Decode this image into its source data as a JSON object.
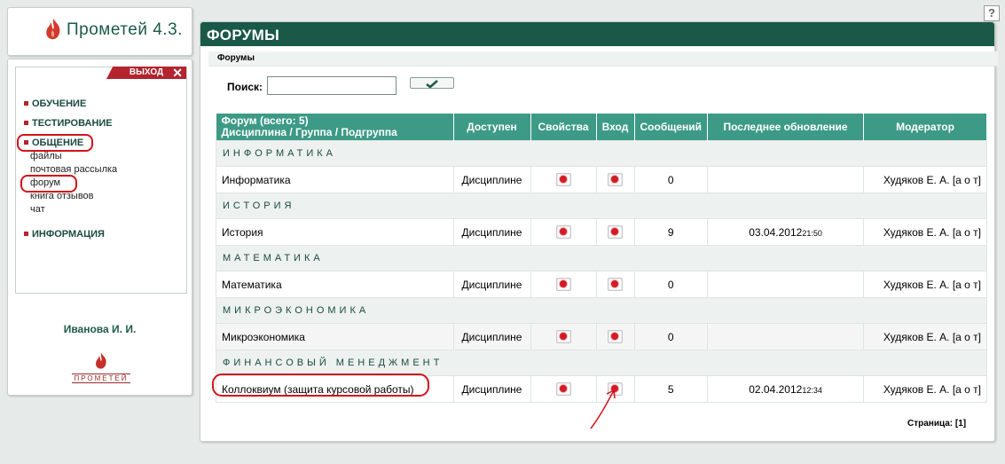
{
  "header": {
    "logo_text": "Прометей 4.3.",
    "help_label": "?"
  },
  "sidebar": {
    "exit_label": "ВЫХОД",
    "menu": [
      {
        "label": "ОБУЧЕНИЕ"
      },
      {
        "label": "ТЕСТИРОВАНИЕ"
      },
      {
        "label": "ОБЩЕНИЕ"
      }
    ],
    "submenu": [
      "файлы",
      "почтовая рассылка",
      "форум",
      "книга отзывов",
      "чат"
    ],
    "info_label": "ИНФОРМАЦИЯ",
    "user_name": "Иванова И. И.",
    "bottom_logo_text": "ПРОМЕТЕЙ"
  },
  "main": {
    "title": "ФОРУМЫ",
    "breadcrumb": "Форумы",
    "search_label": "Поиск:",
    "search_value": "",
    "pager_label": "Страница: [1]"
  },
  "table": {
    "headers": {
      "forum_line1": "Форум (всего: 5)",
      "forum_line2": "Дисциплина / Группа / Подгруппа",
      "available": "Доступен",
      "properties": "Свойства",
      "enter": "Вход",
      "messages": "Сообщений",
      "last_update": "Последнее обновление",
      "moderator": "Модератор"
    },
    "groups": [
      {
        "name": "Информатика",
        "row": {
          "forum": "Информатика",
          "available": "Дисциплине",
          "messages": "0",
          "date": "",
          "time": "",
          "moderator": "Худяков Е. А. [а о т]"
        }
      },
      {
        "name": "История",
        "row": {
          "forum": "История",
          "available": "Дисциплине",
          "messages": "9",
          "date": "03.04.2012",
          "time": "21:50",
          "moderator": "Худяков Е. А. [а о т]"
        }
      },
      {
        "name": "Математика",
        "row": {
          "forum": "Математика",
          "available": "Дисциплине",
          "messages": "0",
          "date": "",
          "time": "",
          "moderator": "Худяков Е. А. [а о т]"
        }
      },
      {
        "name": "Микроэкономика",
        "row": {
          "forum": "Микроэкономика",
          "available": "Дисциплине",
          "messages": "0",
          "date": "",
          "time": "",
          "moderator": "Худяков Е. А. [а о т]"
        }
      },
      {
        "name": "Финансовый менеджмент",
        "row": {
          "forum": "Коллоквиум (защита курсовой работы)",
          "available": "Дисциплине",
          "messages": "5",
          "date": "02.04.2012",
          "time": "12:34",
          "moderator": "Худяков Е. А. [а о т]"
        }
      }
    ]
  },
  "colors": {
    "brand": "#1a5847",
    "header_row": "#3d9a86",
    "accent_red": "#b3242f",
    "annotation": "#d1141b"
  }
}
